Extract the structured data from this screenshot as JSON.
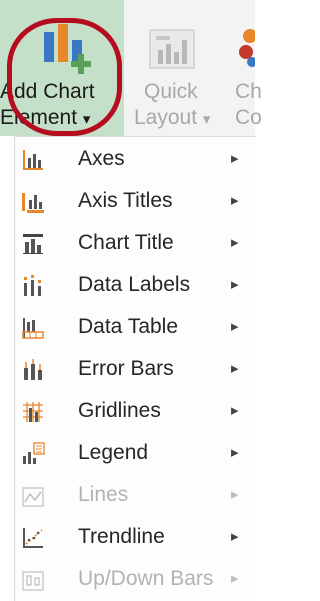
{
  "ribbon": {
    "add_chart_element": {
      "line1": "Add Chart",
      "line2": "Element",
      "caret": "▾",
      "icon": "add-chart-element-icon"
    },
    "quick_layout": {
      "line1": "Quick",
      "line2": "Layout",
      "caret": "▾",
      "icon": "quick-layout-icon"
    },
    "change_colors": {
      "line1": "Ch",
      "line2": "Co",
      "icon": "change-colors-icon"
    }
  },
  "menu": {
    "arrow": "▸",
    "items": [
      {
        "label": "Axes",
        "icon": "axes-icon",
        "enabled": true
      },
      {
        "label": "Axis Titles",
        "icon": "axis-titles-icon",
        "enabled": true
      },
      {
        "label": "Chart Title",
        "icon": "chart-title-icon",
        "enabled": true
      },
      {
        "label": "Data Labels",
        "icon": "data-labels-icon",
        "enabled": true
      },
      {
        "label": "Data Table",
        "icon": "data-table-icon",
        "enabled": true
      },
      {
        "label": "Error Bars",
        "icon": "error-bars-icon",
        "enabled": true
      },
      {
        "label": "Gridlines",
        "icon": "gridlines-icon",
        "enabled": true
      },
      {
        "label": "Legend",
        "icon": "legend-icon",
        "enabled": true
      },
      {
        "label": "Lines",
        "icon": "lines-icon",
        "enabled": false
      },
      {
        "label": "Trendline",
        "icon": "trendline-icon",
        "enabled": true
      },
      {
        "label": "Up/Down Bars",
        "icon": "up-down-bars-icon",
        "enabled": false
      }
    ]
  },
  "colors": {
    "accent_orange": "#e8862a",
    "highlight_ring": "#b50d1f",
    "button_selected": "#c5e0c9",
    "disabled_text": "#b2b2b2"
  }
}
